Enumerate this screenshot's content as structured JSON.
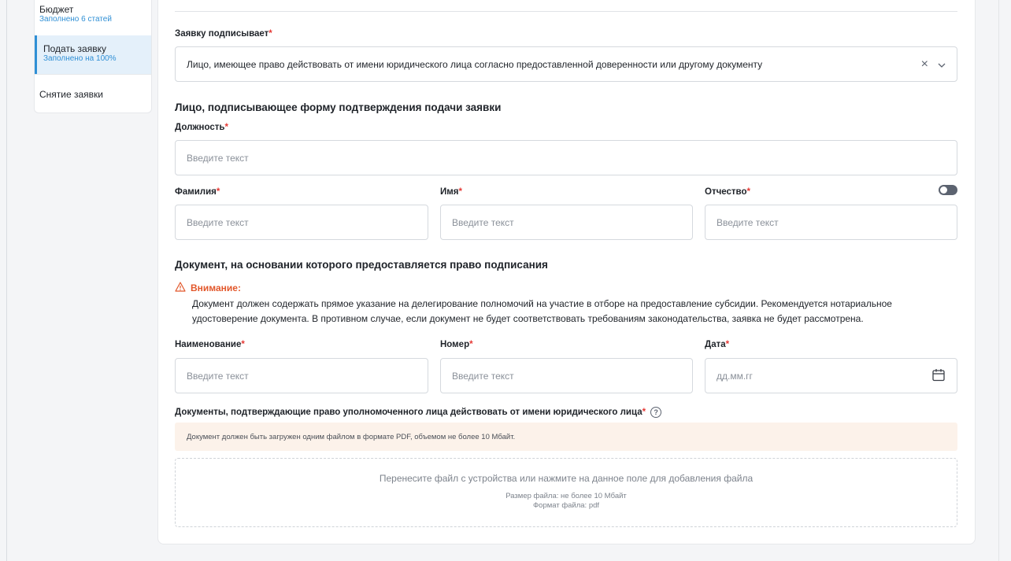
{
  "sidebar": {
    "items": [
      {
        "title": "Бюджет",
        "sub": "Заполнено 6 статей"
      },
      {
        "title": "Подать заявку",
        "sub": "Заполнено на 100%"
      },
      {
        "title": "Снятие заявки"
      }
    ]
  },
  "signer": {
    "label": "Заявку подписывает",
    "value": "Лицо, имеющее право действовать от имени юридического лица согласно предоставленной доверенности или другому документу"
  },
  "person_section": {
    "title": "Лицо, подписывающее форму подтверждения подачи заявки",
    "position_label": "Должность",
    "surname_label": "Фамилия",
    "name_label": "Имя",
    "patronymic_label": "Отчество",
    "placeholder": "Введите текст"
  },
  "document_section": {
    "title": "Документ, на основании которого предоставляется право подписания",
    "warning_title": "Внимание:",
    "warning_text_1": "Документ должен содержать прямое указание на делегирование полномочий на участие в отборе на предоставление субсидии. Рекомендуется нотариальное",
    "warning_text_2": "удостоверение документа. В противном случае, если документ не будет соответствовать требованиям законодательства, заявка не будет рассмотрена.",
    "name_label": "Наименование",
    "number_label": "Номер",
    "date_label": "Дата",
    "date_placeholder": "дд.мм.гг"
  },
  "upload": {
    "label": "Документы, подтверждающие право уполномоченного лица действовать от имени юридического лица",
    "notice": "Документ должен быть загружен одним файлом в формате PDF, объемом не более 10 Мбайт.",
    "dropzone_text": "Перенесите файл с устройства или нажмите на данное поле для добавления файла",
    "size_hint": "Размер файла: не более 10 Мбайт",
    "format_hint": "Формат файла: pdf"
  },
  "required_mark": "*",
  "icons": {
    "clear": "×",
    "chevron": "⌄",
    "help": "?"
  }
}
